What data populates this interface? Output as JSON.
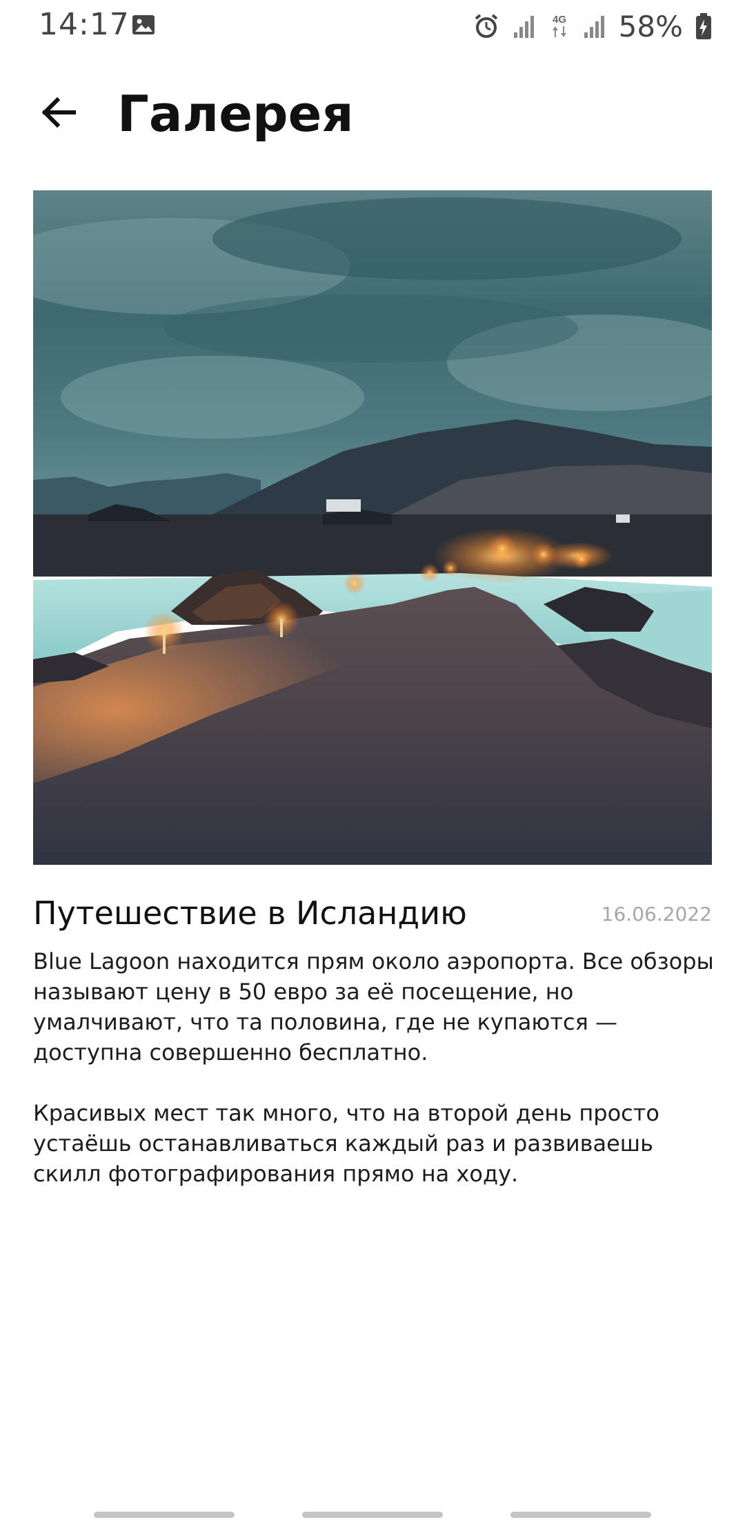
{
  "status_bar": {
    "time": "14:17",
    "battery_percent": "58%",
    "network_label": "4G",
    "icons": [
      "gallery-icon",
      "alarm-icon",
      "signal-icon",
      "4g-icon",
      "signal-icon",
      "battery-charging-icon"
    ]
  },
  "app_bar": {
    "title": "Галерея",
    "back_icon": "arrow-left-icon"
  },
  "article": {
    "title": "Путешествие в Исландию",
    "date": "16.06.2022",
    "paragraphs": [
      "Blue Lagoon находится прям около аэропорта. Все обзоры называют цену в 50 евро за её посещение, но умалчивают, что та половина, где не купаются — доступна совершенно бесплатно.",
      "Красивых мест так много, что на второй день просто устаёшь останавливаться каждый раз и развиваешь скилл фотографирования прямо на ходу."
    ]
  },
  "colors": {
    "accent_text": "#111111",
    "date_text": "#a6a6a6",
    "sky": "#3f6c72",
    "lagoon": "#93d1cf",
    "lights": "#ffb347"
  }
}
